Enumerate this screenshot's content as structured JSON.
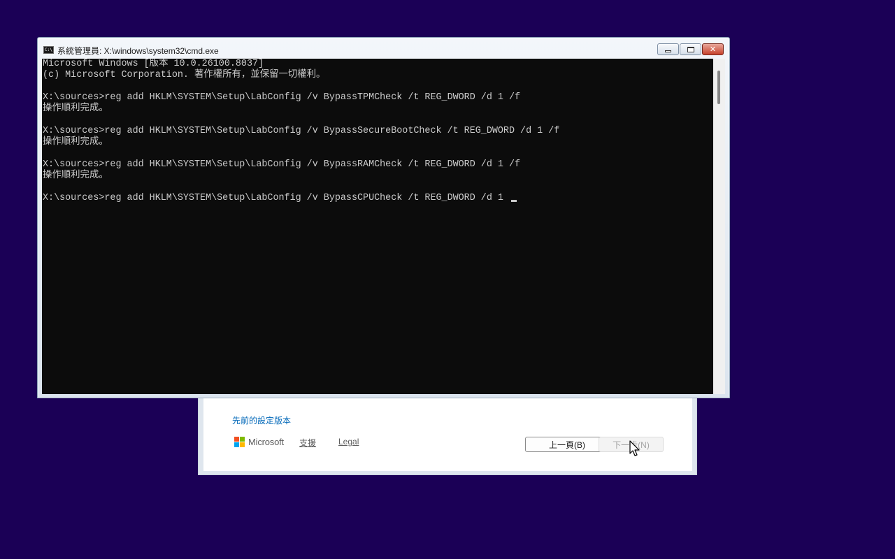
{
  "desktop": {
    "background": "#1b0056"
  },
  "setup": {
    "prev_settings_link": "先前的設定版本",
    "brand": "Microsoft",
    "support_link": "支援",
    "legal_link": "Legal",
    "back_button": "上一頁(B)",
    "next_button": "下一步(N)",
    "next_enabled": false,
    "logo_colors": [
      "#f25022",
      "#7fba00",
      "#00a4ef",
      "#ffb900"
    ]
  },
  "cmd": {
    "title": "系統管理員: X:\\windows\\system32\\cmd.exe",
    "icon": "cmd-icon",
    "controls": {
      "minimize": "minimize-icon",
      "maximize": "maximize-icon",
      "close": "close-icon",
      "close_glyph": "✕"
    },
    "lines": [
      "Microsoft Windows [版本 10.0.26100.8037]",
      "(c) Microsoft Corporation. 著作權所有，並保留一切權利。",
      "",
      "X:\\sources>reg add HKLM\\SYSTEM\\Setup\\LabConfig /v BypassTPMCheck /t REG_DWORD /d 1 /f",
      "操作順利完成。",
      "",
      "X:\\sources>reg add HKLM\\SYSTEM\\Setup\\LabConfig /v BypassSecureBootCheck /t REG_DWORD /d 1 /f",
      "操作順利完成。",
      "",
      "X:\\sources>reg add HKLM\\SYSTEM\\Setup\\LabConfig /v BypassRAMCheck /t REG_DWORD /d 1 /f",
      "操作順利完成。",
      "",
      "X:\\sources>reg add HKLM\\SYSTEM\\Setup\\LabConfig /v BypassCPUCheck /t REG_DWORD /d 1 "
    ],
    "background": "#0c0c0c",
    "foreground": "#cccccc"
  }
}
